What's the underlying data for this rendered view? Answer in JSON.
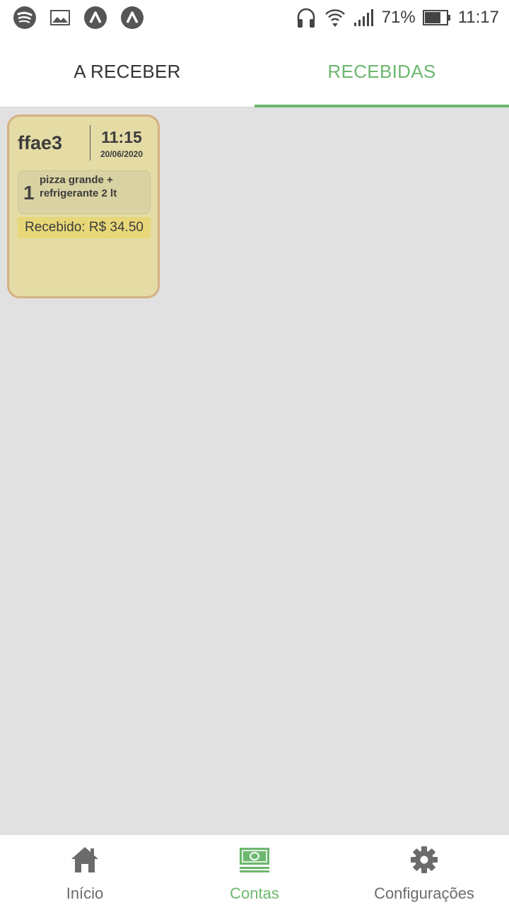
{
  "status_bar": {
    "left_icons": [
      "spotify-icon",
      "image-icon",
      "app-a-icon",
      "app-a-icon"
    ],
    "battery_percent": "71%",
    "time": "11:17"
  },
  "tabs": [
    {
      "label": "A RECEBER",
      "active": false
    },
    {
      "label": "RECEBIDAS",
      "active": true
    }
  ],
  "accent_color": "#6db76f",
  "cards": [
    {
      "name": "ffae3",
      "time": "11:15",
      "date": "20/06/2020",
      "items": [
        {
          "qty": "1",
          "description": "pizza grande + refrigerante 2 lt"
        }
      ],
      "received_label": "Recebido: R$ 34.50"
    }
  ],
  "bottom_nav": [
    {
      "label": "Início",
      "icon": "home-icon",
      "active": false
    },
    {
      "label": "Contas",
      "icon": "money-icon",
      "active": true
    },
    {
      "label": "Configurações",
      "icon": "gear-icon",
      "active": false
    }
  ]
}
